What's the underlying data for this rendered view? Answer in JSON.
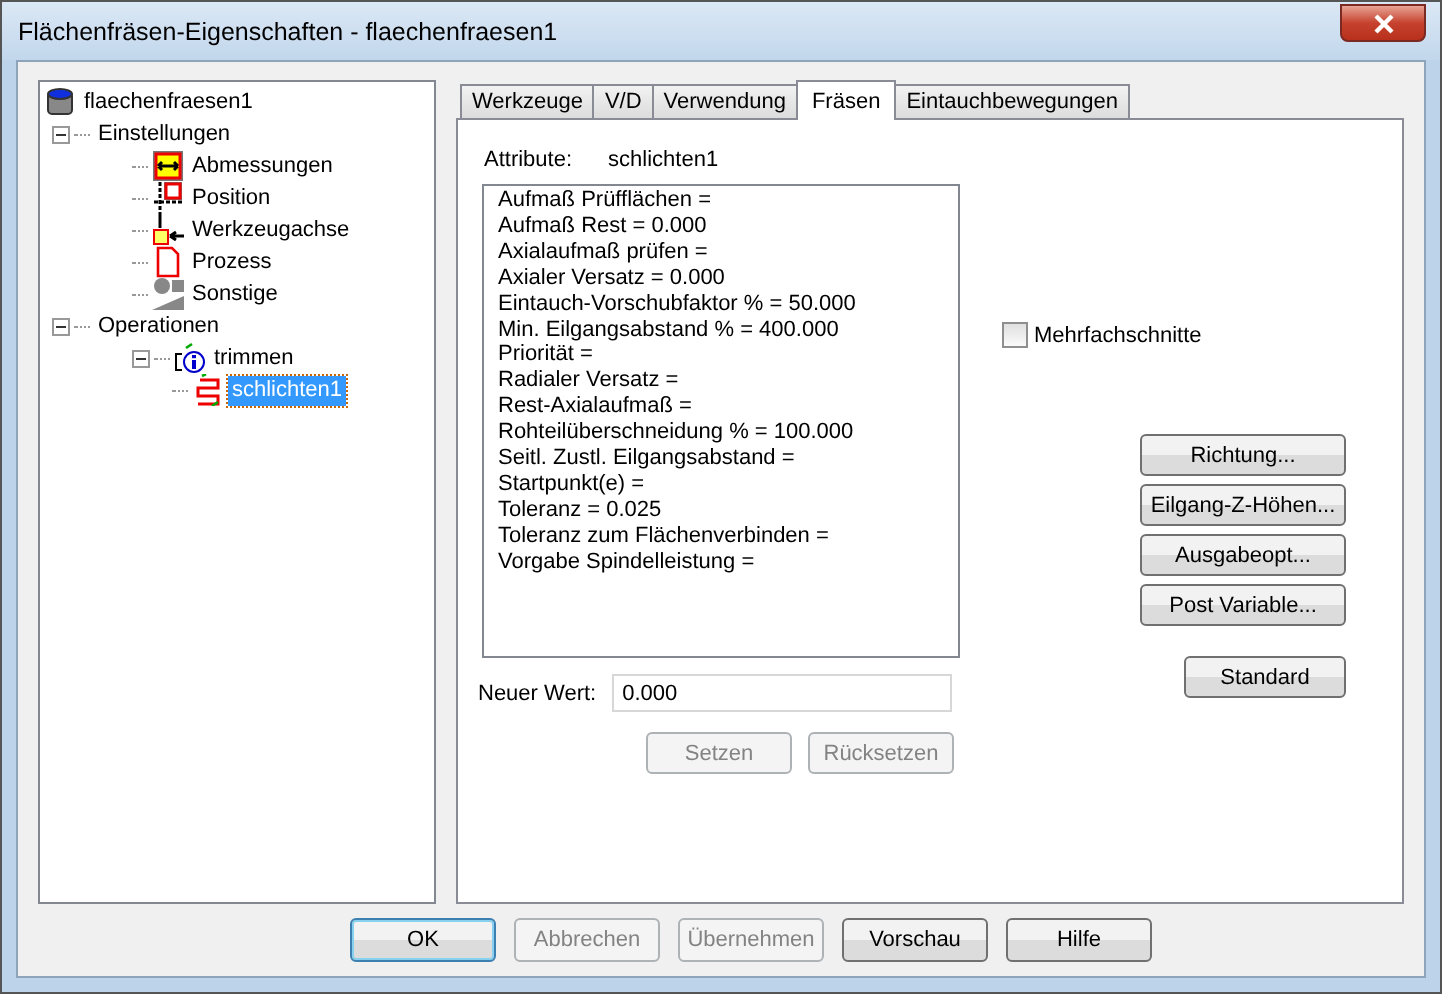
{
  "window": {
    "title": "Flächenfräsen-Eigenschaften - flaechenfraesen1"
  },
  "tree": [
    {
      "label": "flaechenfraesen1",
      "kind": "part",
      "selected": false,
      "children": [
        {
          "label": "Einstellungen",
          "kind": "folder",
          "expanded": true,
          "selected": false,
          "children": [
            {
              "label": "Abmessungen",
              "kind": "dimensions",
              "selected": false
            },
            {
              "label": "Position",
              "kind": "position",
              "selected": false
            },
            {
              "label": "Werkzeugachse",
              "kind": "axis",
              "selected": false
            },
            {
              "label": "Prozess",
              "kind": "process",
              "selected": false
            },
            {
              "label": "Sonstige",
              "kind": "misc",
              "selected": false
            }
          ]
        },
        {
          "label": "Operationen",
          "kind": "folder",
          "expanded": true,
          "selected": false,
          "children": [
            {
              "label": "trimmen",
              "kind": "group",
              "expanded": true,
              "selected": false,
              "children": [
                {
                  "label": "schlichten1",
                  "kind": "operation",
                  "selected": true
                }
              ]
            }
          ]
        }
      ]
    }
  ],
  "tabs": [
    {
      "label": "Werkzeuge",
      "selected": false
    },
    {
      "label": "V/D",
      "selected": false
    },
    {
      "label": "Verwendung",
      "selected": false
    },
    {
      "label": "Fräsen",
      "selected": true
    },
    {
      "label": "Eintauchbewegungen",
      "selected": false
    }
  ],
  "attribute": {
    "label": "Attribute:",
    "value": "schlichten1"
  },
  "attributes": [
    "Aufmaß Prüfflächen =",
    "Aufmaß Rest = 0.000",
    "Axialaufmaß prüfen =",
    "Axialer Versatz = 0.000",
    "Eintauch-Vorschubfaktor % = 50.000",
    "Min. Eilgangsabstand % = 400.000",
    "Priorität =",
    "Radialer Versatz =",
    "Rest-Axialaufmaß =",
    "Rohteilüberschneidung % = 100.000",
    "Seitl. Zustl. Eilgangsabstand =",
    "Startpunkt(e) =",
    "Toleranz = 0.025",
    "Toleranz zum Flächenverbinden =",
    "Vorgabe Spindelleistung ="
  ],
  "new_value": {
    "label": "Neuer Wert:",
    "value": "0.000"
  },
  "value_buttons": [
    {
      "label": "Setzen",
      "disabled": true
    },
    {
      "label": "Rücksetzen",
      "disabled": true
    }
  ],
  "checkbox": {
    "label": "Mehrfachschnitte",
    "checked": false
  },
  "side_buttons": [
    {
      "label": "Richtung..."
    },
    {
      "label": "Eilgang-Z-Höhen..."
    },
    {
      "label": "Ausgabeopt..."
    },
    {
      "label": "Post Variable..."
    }
  ],
  "standard_button": {
    "label": "Standard"
  },
  "buttons": [
    {
      "label": "OK",
      "disabled": false,
      "default": true
    },
    {
      "label": "Abbrechen",
      "disabled": true,
      "default": false
    },
    {
      "label": "Übernehmen",
      "disabled": true,
      "default": false
    },
    {
      "label": "Vorschau",
      "disabled": false,
      "default": false
    },
    {
      "label": "Hilfe",
      "disabled": false,
      "default": false
    }
  ]
}
